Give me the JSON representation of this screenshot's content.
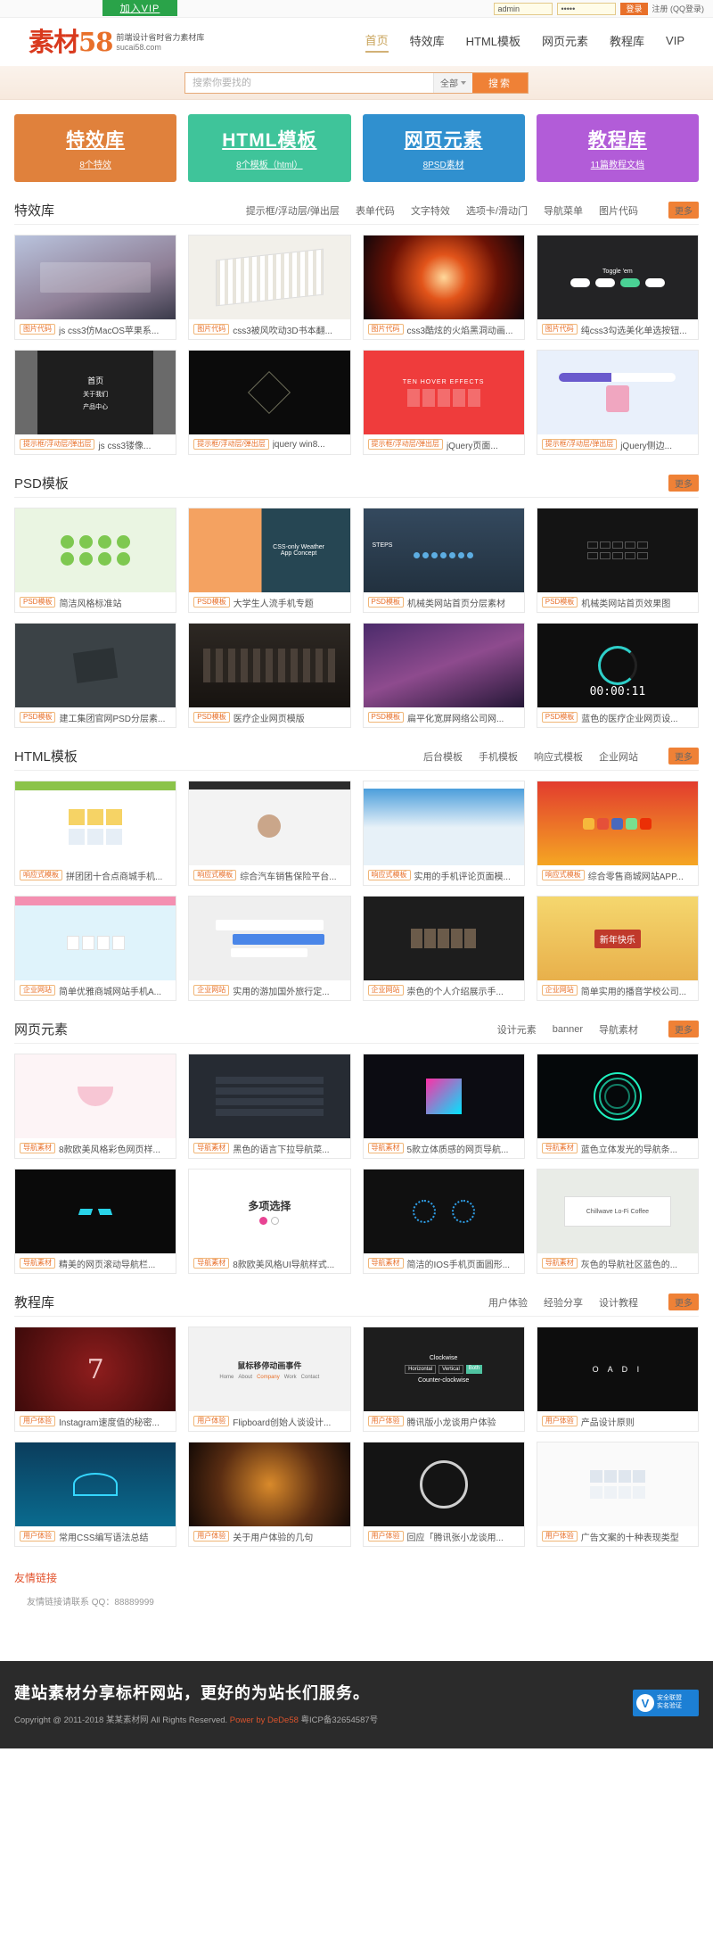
{
  "topbar": {
    "vip_label": "加入VIP",
    "username_value": "admin",
    "password_value": "•••••",
    "login_button": "登录",
    "links": "注册 (QQ登录)"
  },
  "header": {
    "logo_text": "素材",
    "logo_number": "58",
    "logo_sub_1": "前端设计省时省力素材库",
    "logo_sub_2": "sucai58.com",
    "nav": [
      {
        "label": "首页",
        "active": true
      },
      {
        "label": "特效库",
        "active": false
      },
      {
        "label": "HTML模板",
        "active": false
      },
      {
        "label": "网页元素",
        "active": false
      },
      {
        "label": "教程库",
        "active": false
      },
      {
        "label": "VIP",
        "active": false
      }
    ]
  },
  "search": {
    "placeholder": "搜索你要找的",
    "value": "",
    "scope": "全部",
    "button": "搜索"
  },
  "banners": [
    {
      "title": "特效库",
      "sub": "8个特效",
      "color": "#e0813c"
    },
    {
      "title": "HTML模板",
      "sub": "8个模板（html）",
      "color": "#3fc49a"
    },
    {
      "title": "网页元素",
      "sub": "8PSD素材",
      "color": "#3090cf"
    },
    {
      "title": "教程库",
      "sub": "11篇教程文档",
      "color": "#b25cd8"
    }
  ],
  "sections": [
    {
      "title": "特效库",
      "tabs": [
        "提示框/浮动层/弹出层",
        "表单代码",
        "文字特效",
        "选项卡/滑动门",
        "导航菜单",
        "图片代码"
      ],
      "more": "更多",
      "rows": [
        [
          {
            "tag": "图片代码",
            "title": "js css3仿MacOS苹果系...",
            "thumb": "macos-dock"
          },
          {
            "tag": "图片代码",
            "title": "css3被风吹动3D书本翻...",
            "thumb": "book-flip"
          },
          {
            "tag": "图片代码",
            "title": "css3酷炫的火焰黑洞动画...",
            "thumb": "fire-hole"
          },
          {
            "tag": "图片代码",
            "title": "纯css3勾选美化单选按钮...",
            "thumb": "toggle-em"
          }
        ],
        [
          {
            "tag": "提示框/浮动层/弹出层",
            "title": "js css3镂像...",
            "thumb": "product-center"
          },
          {
            "tag": "提示框/浮动层/弹出层",
            "title": "jquery win8...",
            "thumb": "dark-logo"
          },
          {
            "tag": "提示框/浮动层/弹出层",
            "title": "jQuery页面...",
            "thumb": "ten-hover"
          },
          {
            "tag": "提示框/浮动层/弹出层",
            "title": "jQuery侧边...",
            "thumb": "checkpoint"
          }
        ]
      ]
    },
    {
      "title": "PSD模板",
      "tabs": [],
      "more": "更多",
      "rows": [
        [
          {
            "tag": "PSD模板",
            "title": "简洁风格标准站",
            "thumb": "frogs"
          },
          {
            "tag": "PSD模板",
            "title": "大学生人流手机专题",
            "thumb": "weather-app"
          },
          {
            "tag": "PSD模板",
            "title": "机械类网站首页分层素材",
            "thumb": "steps-dash"
          },
          {
            "tag": "PSD模板",
            "title": "机械类网站首页效果图",
            "thumb": "dark-menu"
          }
        ],
        [
          {
            "tag": "PSD模板",
            "title": "建工集团官网PSD分层素...",
            "thumb": "blackboard"
          },
          {
            "tag": "PSD模板",
            "title": "医疗企业网页模版",
            "thumb": "city-dark"
          },
          {
            "tag": "PSD模板",
            "title": "扁平化宽屏网络公司网...",
            "thumb": "purple-night"
          },
          {
            "tag": "PSD模板",
            "title": "蓝色的医疗企业网页设...",
            "thumb": "timer"
          }
        ]
      ]
    },
    {
      "title": "HTML模板",
      "tabs": [
        "后台模板",
        "手机模板",
        "响应式模板",
        "企业网站"
      ],
      "more": "更多",
      "rows": [
        [
          {
            "tag": "响应式模板",
            "title": "拼团团十合点商城手机...",
            "thumb": "shop-grid"
          },
          {
            "tag": "响应式模板",
            "title": "综合汽车销售保险平台...",
            "thumb": "person-site"
          },
          {
            "tag": "响应式模板",
            "title": "实用的手机评论页面模...",
            "thumb": "blue-site"
          },
          {
            "tag": "响应式模板",
            "title": "综合零售商城网站APP...",
            "thumb": "red-promo"
          }
        ],
        [
          {
            "tag": "企业网站",
            "title": "简单优雅商城网站手机A...",
            "thumb": "pink-shop"
          },
          {
            "tag": "企业网站",
            "title": "实用的游加国外旅行定...",
            "thumb": "chat-ui"
          },
          {
            "tag": "企业网站",
            "title": "崇色的个人介绍展示手...",
            "thumb": "dark-gallery"
          },
          {
            "tag": "企业网站",
            "title": "简单实用的播音学校公司...",
            "thumb": "festival"
          }
        ]
      ]
    },
    {
      "title": "网页元素",
      "tabs": [
        "设计元素",
        "banner",
        "导航素材"
      ],
      "more": "更多",
      "rows": [
        [
          {
            "tag": "导航素材",
            "title": "8款欧美风格彩色网页样...",
            "thumb": "lotus"
          },
          {
            "tag": "导航素材",
            "title": "黑色的语言下拉导航菜...",
            "thumb": "dark-panel"
          },
          {
            "tag": "导航素材",
            "title": "5款立体质感的网页导航...",
            "thumb": "pink-cube"
          },
          {
            "tag": "导航素材",
            "title": "蓝色立体发光的导航条...",
            "thumb": "neon-spiral"
          }
        ],
        [
          {
            "tag": "导航素材",
            "title": "精美的网页滚动导航栏...",
            "thumb": "robot-face"
          },
          {
            "tag": "导航素材",
            "title": "8款欧美风格UI导航样式...",
            "thumb": "multi-choice"
          },
          {
            "tag": "导航素材",
            "title": "简洁的IOS手机页面圆形...",
            "thumb": "blue-dots"
          },
          {
            "tag": "导航素材",
            "title": "灰色的导航社区蓝色的...",
            "thumb": "coffee-card"
          }
        ]
      ]
    },
    {
      "title": "教程库",
      "tabs": [
        "用户体验",
        "经验分享",
        "设计教程"
      ],
      "more": "更多",
      "rows": [
        [
          {
            "tag": "用户体验",
            "title": "Instagram速度值的秘密...",
            "thumb": "red-seven"
          },
          {
            "tag": "用户体验",
            "title": "Flipboard创始人谈设计...",
            "thumb": "mouse-anim"
          },
          {
            "tag": "用户体验",
            "title": "腾讯版小龙谈用户体验",
            "thumb": "clockwise"
          },
          {
            "tag": "用户体验",
            "title": "产品设计原则",
            "thumb": "dark-text"
          }
        ],
        [
          {
            "tag": "用户体验",
            "title": "常用CSS编写语法总结",
            "thumb": "car-hud"
          },
          {
            "tag": "用户体验",
            "title": "关于用户体验的几句",
            "thumb": "cosmic"
          },
          {
            "tag": "用户体验",
            "title": "回应「腾讯张小龙谈用...",
            "thumb": "gauge"
          },
          {
            "tag": "用户体验",
            "title": "广告文案的十种表现类型",
            "thumb": "ad-grid"
          }
        ]
      ]
    }
  ],
  "friends": {
    "title": "友情链接",
    "text": "友情链接请联系 QQ：88889999"
  },
  "footer": {
    "slogan": "建站素材分享标杆网站，更好的为站长们服务。",
    "copyright_1": "Copyright @ 2011-2018 某某素材网 All Rights Reserved.",
    "copyright_highlight": "Power by DeDe58",
    "copyright_2": "粤ICP备32654587号",
    "cert_letter": "V",
    "cert_line1": "安全联盟",
    "cert_line2": "实名验证"
  }
}
